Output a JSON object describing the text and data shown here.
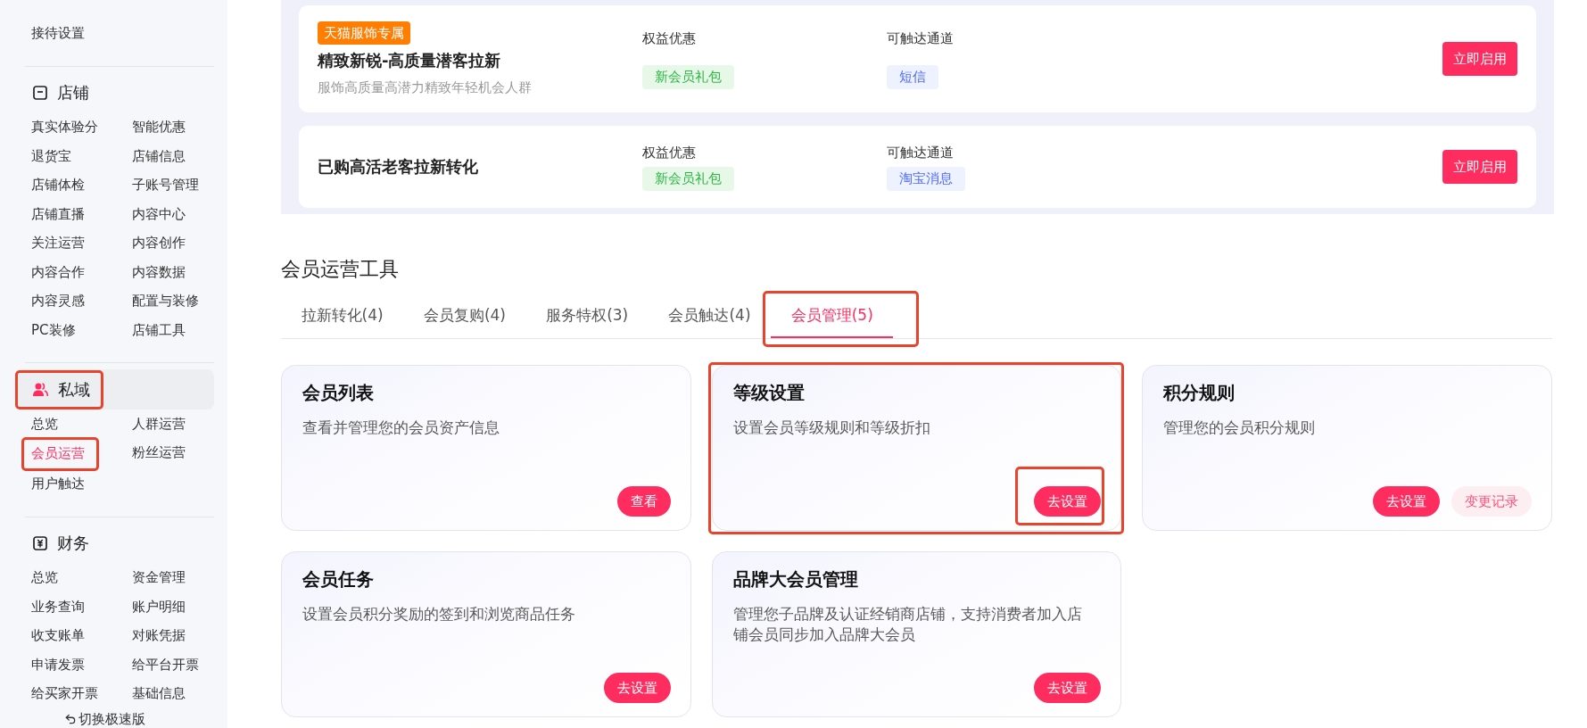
{
  "sidebar": {
    "top_items": [
      {
        "label": "接待设置",
        "selected": false,
        "highlighted": false
      }
    ],
    "sections": [
      {
        "kind": "store",
        "title": "店铺",
        "selected": false,
        "highlighted": false,
        "items": [
          {
            "label": "真实体验分",
            "selected": false,
            "highlighted": false
          },
          {
            "label": "智能优惠",
            "selected": false,
            "highlighted": false
          },
          {
            "label": "退货宝",
            "selected": false,
            "highlighted": false
          },
          {
            "label": "店铺信息",
            "selected": false,
            "highlighted": false
          },
          {
            "label": "店铺体检",
            "selected": false,
            "highlighted": false
          },
          {
            "label": "子账号管理",
            "selected": false,
            "highlighted": false
          },
          {
            "label": "店铺直播",
            "selected": false,
            "highlighted": false
          },
          {
            "label": "内容中心",
            "selected": false,
            "highlighted": false
          },
          {
            "label": "关注运营",
            "selected": false,
            "highlighted": false
          },
          {
            "label": "内容创作",
            "selected": false,
            "highlighted": false
          },
          {
            "label": "内容合作",
            "selected": false,
            "highlighted": false
          },
          {
            "label": "内容数据",
            "selected": false,
            "highlighted": false
          },
          {
            "label": "内容灵感",
            "selected": false,
            "highlighted": false
          },
          {
            "label": "配置与装修",
            "selected": false,
            "highlighted": false
          },
          {
            "label": "PC装修",
            "selected": false,
            "highlighted": false
          },
          {
            "label": "店铺工具",
            "selected": false,
            "highlighted": false
          }
        ]
      },
      {
        "kind": "members",
        "title": "私域",
        "selected": true,
        "highlighted": true,
        "items": [
          {
            "label": "总览",
            "selected": false,
            "highlighted": false
          },
          {
            "label": "人群运营",
            "selected": false,
            "highlighted": false
          },
          {
            "label": "会员运营",
            "selected": true,
            "highlighted": true
          },
          {
            "label": "粉丝运营",
            "selected": false,
            "highlighted": false
          },
          {
            "label": "用户触达",
            "selected": false,
            "highlighted": false
          }
        ]
      },
      {
        "kind": "finance",
        "title": "财务",
        "selected": false,
        "highlighted": false,
        "items": [
          {
            "label": "总览",
            "selected": false,
            "highlighted": false
          },
          {
            "label": "资金管理",
            "selected": false,
            "highlighted": false
          },
          {
            "label": "业务查询",
            "selected": false,
            "highlighted": false
          },
          {
            "label": "账户明细",
            "selected": false,
            "highlighted": false
          },
          {
            "label": "收支账单",
            "selected": false,
            "highlighted": false
          },
          {
            "label": "对账凭据",
            "selected": false,
            "highlighted": false
          },
          {
            "label": "申请发票",
            "selected": false,
            "highlighted": false
          },
          {
            "label": "给平台开票",
            "selected": false,
            "highlighted": false
          },
          {
            "label": "给买家开票",
            "selected": false,
            "highlighted": false
          },
          {
            "label": "基础信息",
            "selected": false,
            "highlighted": false
          }
        ]
      }
    ],
    "switch_link": {
      "label": "切换极速版"
    }
  },
  "campaigns": [
    {
      "badge": "天猫服饰专属",
      "title": "精致新锐-高质量潜客拉新",
      "description": "服饰高质量高潜力精致年轻机会人群",
      "benefit": {
        "label": "权益优惠",
        "tag": "新会员礼包"
      },
      "channel": {
        "label": "可触达通道",
        "tag": "短信"
      },
      "button": "立即启用"
    },
    {
      "title": "已购高活老客拉新转化",
      "benefit": {
        "label": "权益优惠",
        "tag": "新会员礼包"
      },
      "channel": {
        "label": "可触达通道",
        "tag": "淘宝消息"
      },
      "button": "立即启用"
    }
  ],
  "tools": {
    "title": "会员运营工具",
    "tabs": [
      {
        "label": "拉新转化(4)",
        "selected": false,
        "highlighted": false
      },
      {
        "label": "会员复购(4)",
        "selected": false,
        "highlighted": false
      },
      {
        "label": "服务特权(3)",
        "selected": false,
        "highlighted": false
      },
      {
        "label": "会员触达(4)",
        "selected": false,
        "highlighted": false
      },
      {
        "label": "会员管理(5)",
        "selected": true,
        "highlighted": true
      }
    ],
    "cards": [
      {
        "title": "会员列表",
        "description": "查看并管理您的会员资产信息",
        "highlighted": false,
        "buttons": [
          {
            "label": "查看",
            "kind": "primary",
            "highlighted": false
          }
        ]
      },
      {
        "title": "等级设置",
        "description": "设置会员等级规则和等级折扣",
        "highlighted": true,
        "buttons": [
          {
            "label": "去设置",
            "kind": "primary",
            "highlighted": true
          }
        ]
      },
      {
        "title": "积分规则",
        "description": "管理您的会员积分规则",
        "highlighted": false,
        "buttons": [
          {
            "label": "去设置",
            "kind": "primary",
            "highlighted": false
          },
          {
            "label": "变更记录",
            "kind": "secondary",
            "highlighted": false
          }
        ]
      },
      {
        "title": "会员任务",
        "description": "设置会员积分奖励的签到和浏览商品任务",
        "highlighted": false,
        "buttons": [
          {
            "label": "去设置",
            "kind": "primary",
            "highlighted": false
          }
        ]
      },
      {
        "title": "品牌大会员管理",
        "description": "管理您子品牌及认证经销商店铺，支持消费者加入店铺会员同步加入品牌大会员",
        "highlighted": false,
        "buttons": [
          {
            "label": "去设置",
            "kind": "primary",
            "highlighted": false
          }
        ]
      }
    ]
  }
}
